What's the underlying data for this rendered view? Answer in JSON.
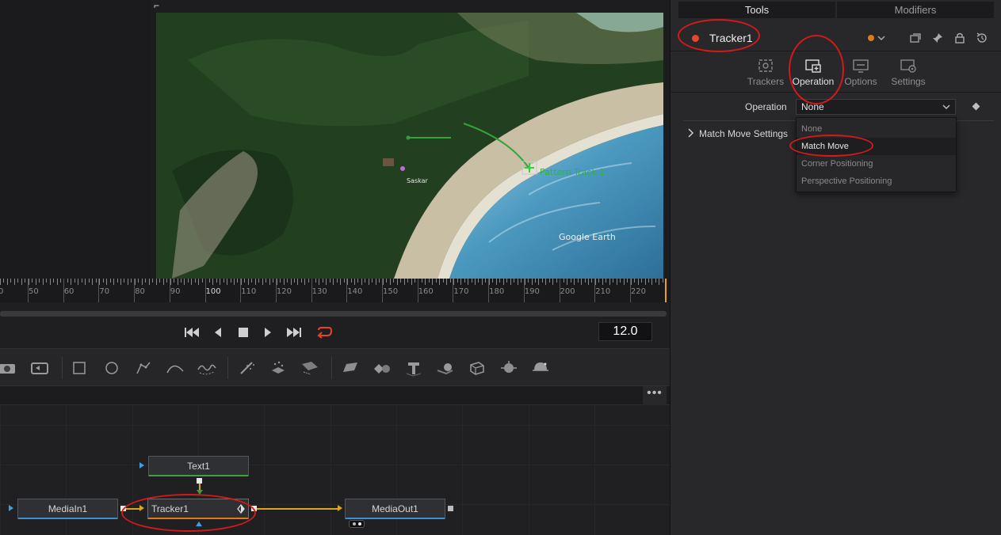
{
  "viewer": {
    "overlay_track_label": "Pattern Track 1",
    "watermark": "Google Earth",
    "place_label": "Saskar"
  },
  "ruler": {
    "labels": [
      "0",
      "50",
      "60",
      "70",
      "80",
      "90",
      "100",
      "110",
      "120",
      "130",
      "140",
      "150",
      "160",
      "170",
      "180",
      "190",
      "200",
      "210",
      "220"
    ]
  },
  "transport": {
    "timecode": "12.0",
    "buttons": [
      "skip-to-start-icon",
      "play-reverse-icon",
      "stop-icon",
      "play-icon",
      "skip-to-end-icon",
      "loop-icon"
    ],
    "loop_color": "#e8432a"
  },
  "toolbar": {
    "tools": [
      "media-in-icon",
      "transform-icon",
      "rectangle-mask-icon",
      "ellipse-mask-icon",
      "polygon-mask-icon",
      "bspline-mask-icon",
      "paint-icon",
      "particle-emitter-icon",
      "particle-render-icon",
      "pixel-grid-icon",
      "image-plane-3d-icon",
      "merge-3d-icon",
      "text-3d-icon",
      "shape-3d-icon",
      "camera-3d-icon",
      "renderer-3d-icon",
      "light-icon"
    ]
  },
  "node_bar": {
    "more_label": "•••"
  },
  "nodes": {
    "text": "Text1",
    "media_in": "MediaIn1",
    "tracker": "Tracker1",
    "media_out": "MediaOut1"
  },
  "panel": {
    "tabs": [
      "Tools",
      "Modifiers"
    ],
    "tool_name": "Tracker1",
    "tool_color": "#e8452c",
    "version_color": "#e07a16",
    "subtabs": [
      "Trackers",
      "Operation",
      "Options",
      "Settings"
    ],
    "operation_label": "Operation",
    "operation_value": "None",
    "match_move_settings": "Match Move Settings",
    "dropdown_options": [
      "None",
      "Match Move",
      "Corner Positioning",
      "Perspective Positioning"
    ],
    "highlighted_option": "Match Move"
  }
}
